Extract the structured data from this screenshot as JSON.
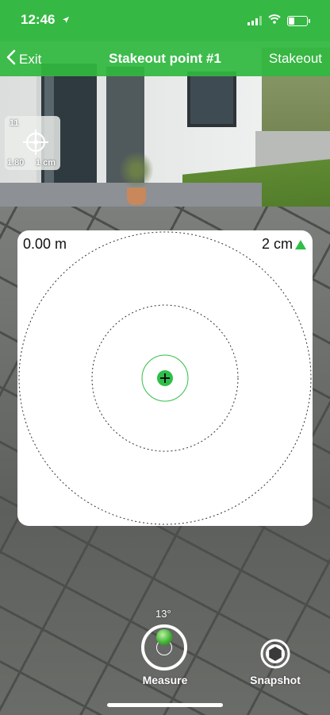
{
  "status_bar": {
    "time": "12:46",
    "battery_level": 0.35,
    "signal_bars": 3
  },
  "nav": {
    "back_label": "Exit",
    "title": "Stakeout point #1",
    "action_label": "Stakeout"
  },
  "accuracy": {
    "satellites": "11",
    "horizontal": "1.80",
    "vertical": "1 cm"
  },
  "target_view": {
    "distance": "0.00 m",
    "height_diff": "2 cm",
    "height_direction": "up",
    "accent_color": "#2fbf49"
  },
  "controls": {
    "tilt": "13°",
    "measure_label": "Measure",
    "snapshot_label": "Snapshot"
  },
  "colors": {
    "header_green": "#35b844",
    "accent_green": "#2fbf49"
  }
}
